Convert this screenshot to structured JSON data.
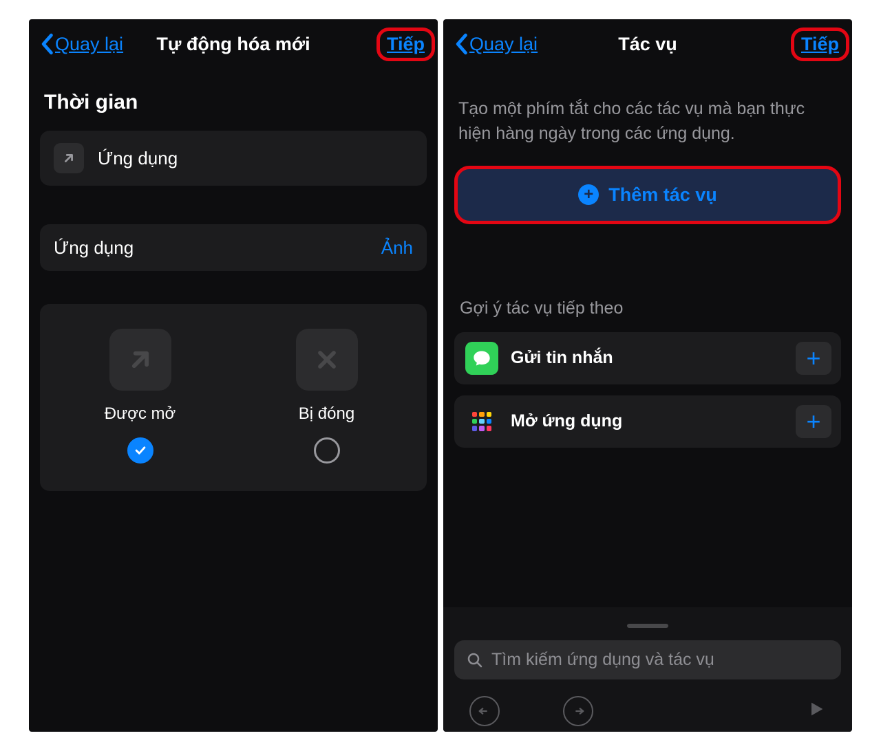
{
  "left": {
    "nav": {
      "back": "Quay lại",
      "title": "Tự động hóa mới",
      "next": "Tiếp"
    },
    "section_title": "Thời gian",
    "app_row_label": "Ứng dụng",
    "app_value_label": "Ứng dụng",
    "app_value": "Ảnh",
    "option_open": "Được mở",
    "option_closed": "Bị đóng"
  },
  "right": {
    "nav": {
      "back": "Quay lại",
      "title": "Tác vụ",
      "next": "Tiếp"
    },
    "description": "Tạo một phím tắt cho các tác vụ mà bạn thực hiện hàng ngày trong các ứng dụng.",
    "add_action": "Thêm tác vụ",
    "suggest_title": "Gợi ý tác vụ tiếp theo",
    "suggestions": [
      {
        "label": "Gửi tin nhắn"
      },
      {
        "label": "Mở ứng dụng"
      }
    ],
    "search_placeholder": "Tìm kiếm ứng dụng và tác vụ"
  }
}
